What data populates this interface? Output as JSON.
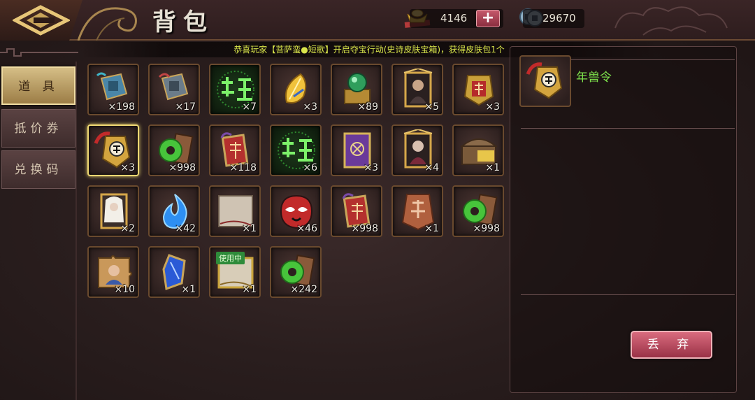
{
  "header": {
    "title": "背包",
    "back_icon": "back-arrow-icon",
    "gold_amount": "4146",
    "coin_amount": "29670",
    "plus_label": "+"
  },
  "announcement": "恭喜玩家【菩萨蛮●短歌】开启夺宝行动(史诗皮肤宝箱)，获得皮肤包1个",
  "tabs": [
    {
      "label": "道 具",
      "active": true
    },
    {
      "label": "抵价券",
      "active": false
    },
    {
      "label": "兑换码",
      "active": false
    }
  ],
  "items": [
    {
      "icon": "blue-token-icon",
      "qty": "×198"
    },
    {
      "icon": "steel-token-icon",
      "qty": "×17"
    },
    {
      "icon": "green-wu-glyph-icon",
      "qty": "×7"
    },
    {
      "icon": "gold-feather-icon",
      "qty": "×3"
    },
    {
      "icon": "jade-orb-chest-icon",
      "qty": "×89"
    },
    {
      "icon": "hero-portrait-card-icon",
      "qty": "×5"
    },
    {
      "icon": "red-gold-token-icon",
      "qty": "×3"
    },
    {
      "icon": "song-token-icon",
      "qty": "×3",
      "selected": true
    },
    {
      "icon": "jade-disc-scroll-icon",
      "qty": "×998"
    },
    {
      "icon": "red-scroll-token-icon",
      "qty": "×118"
    },
    {
      "icon": "green-wu-glyph-icon",
      "qty": "×6"
    },
    {
      "icon": "purple-book-icon",
      "qty": "×3"
    },
    {
      "icon": "hero-portrait-card-icon",
      "qty": "×4"
    },
    {
      "icon": "sp-treasure-chest-icon",
      "qty": "×1"
    },
    {
      "icon": "white-hair-hero-card-icon",
      "qty": "×2"
    },
    {
      "icon": "blue-flame-icon",
      "qty": "×42"
    },
    {
      "icon": "blank-scroll-icon",
      "qty": "×1"
    },
    {
      "icon": "opera-mask-icon",
      "qty": "×46"
    },
    {
      "icon": "red-scroll-token-icon",
      "qty": "×998"
    },
    {
      "icon": "zhonglang-token-icon",
      "qty": "×1"
    },
    {
      "icon": "jade-disc-scroll-icon",
      "qty": "×998"
    },
    {
      "icon": "puzzle-portrait-icon",
      "qty": "×10"
    },
    {
      "icon": "blue-gem-shard-icon",
      "qty": "×1"
    },
    {
      "icon": "gold-frame-scroll-icon",
      "qty": "×1",
      "badge": "使用中"
    },
    {
      "icon": "jade-disc-scroll-icon",
      "qty": "×242"
    }
  ],
  "detail": {
    "icon": "song-token-icon",
    "name": "年兽令"
  },
  "discard_label": "丢 弃",
  "colors": {
    "qty_text": "#f0ece4",
    "item_name": "#7ce04b",
    "announcement": "#d9e54b",
    "selected_border": "#efd873",
    "discard_button": "#c24a5e"
  }
}
